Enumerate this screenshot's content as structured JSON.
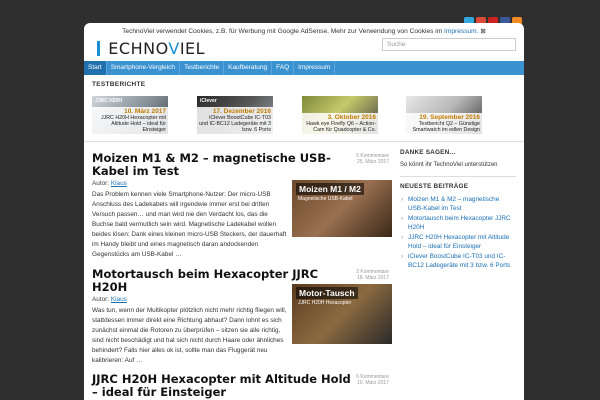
{
  "colors": {
    "accent": "#3a92d1",
    "dark_bg": "#2f2f2f",
    "date": "#c07a00"
  },
  "social_icons": [
    "twitter-icon",
    "google-plus-icon",
    "youtube-icon",
    "facebook-icon",
    "rss-icon"
  ],
  "cookie": {
    "text": "TechnoViel verwendet Cookies, z.B. für Werbung mit Google AdSense. Mehr zur Verwendung von Cookies im ",
    "link": "Impressum.",
    "close": "⊠"
  },
  "logo": {
    "first": "T",
    "rest": "ECHNO",
    "v": "V",
    "end": "IEL"
  },
  "search": {
    "placeholder": "Suche"
  },
  "nav": [
    {
      "label": "Start"
    },
    {
      "label": "Smartphone-Vergleich"
    },
    {
      "label": "Testberichte"
    },
    {
      "label": "Kaufberatung"
    },
    {
      "label": "FAQ"
    },
    {
      "label": "Impressum"
    }
  ],
  "testberichte": {
    "title": "TESTBERICHTE",
    "items": [
      {
        "date": "10. März 2017",
        "title": "JJRC H20H Hexacopter mit Altitude Hold – ideal für Einsteiger",
        "tag": "JJRC H20H"
      },
      {
        "date": "17. Dezember 2016",
        "title": "iClever BoostCube IC-T03 und IC-BC12 Ladegeräte mit 3 bzw. 6 Ports",
        "tag": "iClever"
      },
      {
        "date": "3. Oktober 2016",
        "title": "Hawk eye Firefly Q6 – Action-Cam für Quadcopter & Co.",
        "tag": ""
      },
      {
        "date": "19. September 2016",
        "title": "Testbericht Q2 – Günstige Smartwatch im edlen Design",
        "tag": ""
      }
    ]
  },
  "posts": [
    {
      "title": "Moizen M1 & M2 – magnetische USB-Kabel im Test",
      "comments": "5 Kommentare",
      "date": "25. März 2017",
      "author_label": "Autor:",
      "author": "Klaus",
      "excerpt": "Das Problem kennen viele Smartphone-Nutzer: Der micro-USB Anschluss des Ladekabels will irgendwie immer erst bei dritten Versuch passen… und man wird nie den Verdacht los, das die Buchse bald vermutlich sein wird. Magnetische Ladekabel wollen beides lösen: Dank eines kleinen micro-USB Steckers, der dauerhaft im Handy bleibt und eines magnetisch daran andockenden Gegenstücks am USB-Kabel …",
      "thumb_label": "Moizen M1 / M2",
      "thumb_sub": "Magnetische USB-Kabel"
    },
    {
      "title": "Motortausch beim Hexacopter JJRC H20H",
      "comments": "2 Kommentare",
      "date": "18. März 2017",
      "author_label": "Autor:",
      "author": "Klaus",
      "excerpt": "Was tun, wenn der Multikopter plötzlich nicht mehr richtig fliegen will, stattdessen immer direkt eine Richtung abhaut? Dann lohnt es sich zunächst einmal die Rotoren zu überprüfen – sitzen sie alle richtig, sind nicht beschädigt und hat sich nicht durch Haare oder ähnliches behindert? Falls hier alles ok ist, sollte man das Fluggerät neu kalibrieren: Auf …",
      "thumb_label": "Motor-Tausch",
      "thumb_sub": "JJRC H20H Hexacopter"
    },
    {
      "title": "JJRC H20H Hexacopter mit Altitude Hold – ideal für Einsteiger",
      "comments": "6 Kommentare",
      "date": "10. März 2017"
    }
  ],
  "sidebar": {
    "thanks_title": "DANKE SAGEN...",
    "thanks_text": "So könnt ihr TechnoViel unterstützen",
    "recent_title": "NEUESTE BEITRÄGE",
    "recent": [
      "Moizen M1 & M2 – magnetische USB-Kabel im Test",
      "Motortausch beim Hexacopter JJRC H20H",
      "JJRC H20H Hexacopter mit Altitude Hold – ideal für Einsteiger",
      "iClever BoostCube IC-T03 und IC-BC12 Ladegeräte mit 3 bzw. 6 Ports"
    ]
  }
}
